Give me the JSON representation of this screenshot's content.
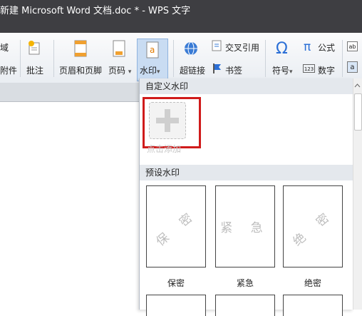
{
  "window": {
    "title": "新建 Microsoft Word 文档.doc * - WPS 文字"
  },
  "ribbon": {
    "partial_top": "域",
    "attachment": "附件",
    "comment": "批注",
    "header_footer": "页眉和页脚",
    "page_number": "页码",
    "watermark": "水印",
    "hyperlink": "超链接",
    "cross_ref": "交叉引用",
    "bookmark": "书签",
    "symbol": "符号",
    "formula": "公式",
    "number": "数字",
    "chevron": "▾"
  },
  "panel": {
    "custom_header": "自定义水印",
    "add_label": "点击添加",
    "preset_header": "预设水印",
    "presets": [
      {
        "label": "保密",
        "watermark": "保 密"
      },
      {
        "label": "紧急",
        "watermark": "紧 急"
      },
      {
        "label": "绝密",
        "watermark": "绝 密"
      }
    ]
  },
  "colors": {
    "titlebar": "#3e3e42",
    "highlight": "#d01b1b",
    "ribbon_active": "#c9dcf2"
  },
  "icons": [
    "attachment-icon",
    "comment-icon",
    "header-footer-icon",
    "page-number-icon",
    "watermark-icon",
    "hyperlink-icon",
    "cross-ref-icon",
    "bookmark-icon",
    "symbol-icon",
    "formula-icon",
    "number-icon",
    "plus-icon"
  ]
}
